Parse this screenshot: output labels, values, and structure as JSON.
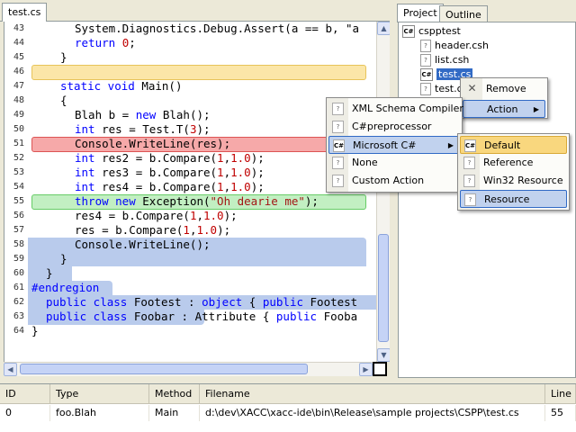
{
  "editor": {
    "tab_label": "test.cs",
    "lines": [
      {
        "n": "43",
        "indent": 3,
        "parts": [
          {
            "t": "System.Diagnostics.Debug.Assert(a == b, \"a"
          }
        ]
      },
      {
        "n": "44",
        "indent": 3,
        "parts": [
          {
            "t": "return ",
            "c": "kw"
          },
          {
            "t": "0",
            "c": "num"
          },
          {
            "t": ";"
          }
        ]
      },
      {
        "n": "45",
        "indent": 2,
        "parts": [
          {
            "t": "}"
          }
        ]
      },
      {
        "n": "46",
        "indent": 0,
        "parts": []
      },
      {
        "n": "47",
        "indent": 2,
        "parts": [
          {
            "t": "static void ",
            "c": "kw"
          },
          {
            "t": "Main()"
          }
        ]
      },
      {
        "n": "48",
        "indent": 2,
        "parts": [
          {
            "t": "{"
          }
        ]
      },
      {
        "n": "49",
        "indent": 3,
        "parts": [
          {
            "t": "Blah b = "
          },
          {
            "t": "new ",
            "c": "kw"
          },
          {
            "t": "Blah();"
          }
        ]
      },
      {
        "n": "50",
        "indent": 3,
        "parts": [
          {
            "t": "int ",
            "c": "kw"
          },
          {
            "t": "res = Test.T("
          },
          {
            "t": "3",
            "c": "num"
          },
          {
            "t": ");"
          }
        ]
      },
      {
        "n": "51",
        "indent": 3,
        "parts": [
          {
            "t": "Console.WriteLine(res);"
          }
        ]
      },
      {
        "n": "52",
        "indent": 3,
        "parts": [
          {
            "t": "int ",
            "c": "kw"
          },
          {
            "t": "res2 = b.Compare("
          },
          {
            "t": "1",
            "c": "num"
          },
          {
            "t": ","
          },
          {
            "t": "1.0",
            "c": "num"
          },
          {
            "t": ");"
          }
        ]
      },
      {
        "n": "53",
        "indent": 3,
        "parts": [
          {
            "t": "int ",
            "c": "kw"
          },
          {
            "t": "res3 = b.Compare("
          },
          {
            "t": "1",
            "c": "num"
          },
          {
            "t": ","
          },
          {
            "t": "1.0",
            "c": "num"
          },
          {
            "t": ");"
          }
        ]
      },
      {
        "n": "54",
        "indent": 3,
        "parts": [
          {
            "t": "int ",
            "c": "kw"
          },
          {
            "t": "res4 = b.Compare("
          },
          {
            "t": "1",
            "c": "num"
          },
          {
            "t": ","
          },
          {
            "t": "1.0",
            "c": "num"
          },
          {
            "t": ");"
          }
        ]
      },
      {
        "n": "55",
        "indent": 3,
        "parts": [
          {
            "t": "throw new ",
            "c": "kw"
          },
          {
            "t": "Exception("
          },
          {
            "t": "\"Oh dearie me\"",
            "c": "str"
          },
          {
            "t": ");"
          }
        ]
      },
      {
        "n": "56",
        "indent": 3,
        "parts": [
          {
            "t": "res4 = b.Compare("
          },
          {
            "t": "1",
            "c": "num"
          },
          {
            "t": ","
          },
          {
            "t": "1.0",
            "c": "num"
          },
          {
            "t": ");"
          }
        ]
      },
      {
        "n": "57",
        "indent": 3,
        "parts": [
          {
            "t": "res = b.Compare("
          },
          {
            "t": "1",
            "c": "num"
          },
          {
            "t": ","
          },
          {
            "t": "1.0",
            "c": "num"
          },
          {
            "t": ");"
          }
        ]
      },
      {
        "n": "58",
        "indent": 3,
        "parts": [
          {
            "t": "Console.WriteLine();"
          }
        ]
      },
      {
        "n": "59",
        "indent": 2,
        "parts": [
          {
            "t": "}"
          }
        ]
      },
      {
        "n": "60",
        "indent": 1,
        "parts": [
          {
            "t": "}"
          }
        ]
      },
      {
        "n": "61",
        "indent": 0,
        "parts": [
          {
            "t": "#endregion",
            "c": "kw"
          }
        ]
      },
      {
        "n": "62",
        "indent": 1,
        "parts": [
          {
            "t": "public class ",
            "c": "kw"
          },
          {
            "t": "Footest : "
          },
          {
            "t": "object",
            "c": "kw"
          },
          {
            "t": " { "
          },
          {
            "t": "public ",
            "c": "kw"
          },
          {
            "t": "Footest"
          }
        ]
      },
      {
        "n": "63",
        "indent": 1,
        "parts": [
          {
            "t": "public class ",
            "c": "kw"
          },
          {
            "t": "Foobar : Attribute { "
          },
          {
            "t": "public ",
            "c": "kw"
          },
          {
            "t": "Fooba"
          }
        ]
      },
      {
        "n": "64",
        "indent": 0,
        "parts": [
          {
            "t": "}"
          }
        ]
      }
    ]
  },
  "project": {
    "tabs": [
      "Project",
      "Outline"
    ],
    "root": "cspptest",
    "files": [
      "header.csh",
      "list.csh",
      "test.cs",
      "test.c"
    ],
    "root_icon": "C#",
    "file_icon": "?"
  },
  "file_menu": {
    "items": [
      "Remove",
      "Action"
    ]
  },
  "action_menu": {
    "items": [
      "XML Schema Compiler",
      "C#preprocessor",
      "Microsoft C#",
      "None",
      "Custom Action"
    ],
    "ms_icon": "C#"
  },
  "ms_menu": {
    "items": [
      "Default",
      "Reference",
      "Win32 Resource",
      "Resource"
    ],
    "default_icon": "C#"
  },
  "errors": {
    "headers": [
      "ID",
      "Type",
      "Method",
      "Filename",
      "Line"
    ],
    "rows": [
      {
        "id": "0",
        "type": "foo.Blah",
        "method": "Main",
        "filename": "d:\\dev\\XACC\\xacc-ide\\bin\\Release\\sample projects\\CSPP\\test.cs",
        "line": "55"
      }
    ]
  },
  "colors": {
    "keyword": "#0000ff",
    "number": "#c00000",
    "string": "#a31515",
    "error_highlight": "#f6a9a9",
    "exception_highlight": "#c2efc2",
    "current_line": "#fbe6a8",
    "selection": "#b9cbec",
    "selected_item": "#316ac5"
  }
}
